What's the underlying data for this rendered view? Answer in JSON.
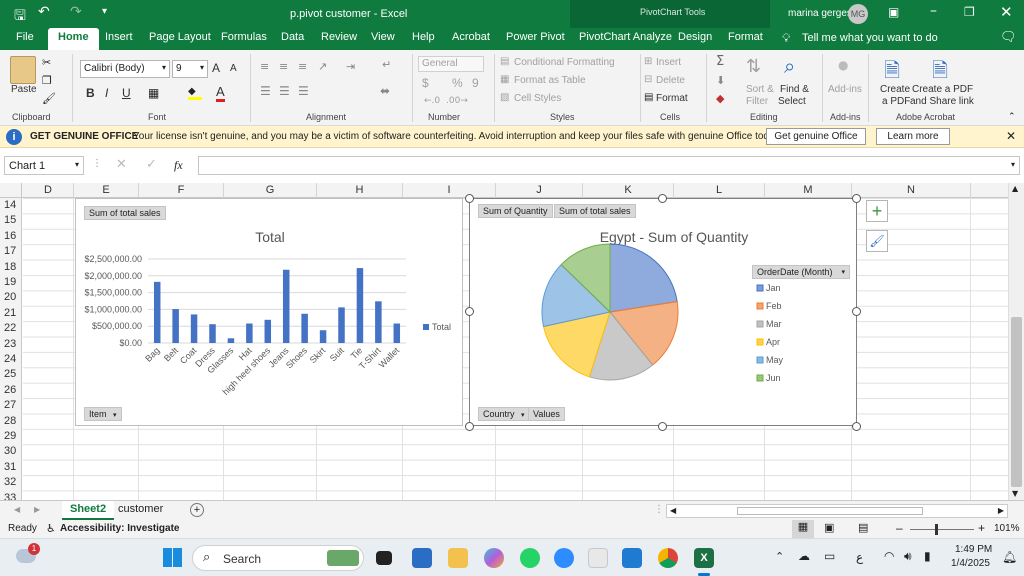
{
  "titlebar": {
    "doc_title": "p.pivot customer  -  Excel",
    "tools_label": "PivotChart Tools",
    "user_name": "marina gerges",
    "user_initials": "MG"
  },
  "tabs": [
    "File",
    "Home",
    "Insert",
    "Page Layout",
    "Formulas",
    "Data",
    "Review",
    "View",
    "Help",
    "Acrobat",
    "Power Pivot",
    "PivotChart Analyze",
    "Design",
    "Format"
  ],
  "active_tab": "Home",
  "tell_me": "Tell me what you want to do",
  "ribbon": {
    "clipboard": {
      "paste": "Paste",
      "label": "Clipboard"
    },
    "font": {
      "name": "Calibri (Body)",
      "size": "9",
      "bold": "B",
      "italic": "I",
      "underline": "U",
      "grow": "A",
      "shrink": "A",
      "label": "Font"
    },
    "alignment": {
      "label": "Alignment"
    },
    "number": {
      "format": "General",
      "currency": "$",
      "percent": "%",
      "comma": "9",
      "label": "Number"
    },
    "styles": {
      "conditional": "Conditional Formatting",
      "table": "Format as Table",
      "cell": "Cell Styles",
      "label": "Styles"
    },
    "cells": {
      "insert": "Insert",
      "delete": "Delete",
      "format": "Format",
      "label": "Cells"
    },
    "editing": {
      "sort": "Sort &",
      "filter": "Filter",
      "find": "Find &",
      "select": "Select",
      "label": "Editing"
    },
    "addins": {
      "name": "Add-ins",
      "label": "Add-ins"
    },
    "acrobat": {
      "create_pdf_1": "Create",
      "create_pdf_2": "a PDF",
      "share_1": "Create a PDF",
      "share_2": "and Share link",
      "label": "Adobe Acrobat"
    }
  },
  "message_bar": {
    "title": "GET GENUINE OFFICE",
    "text": "Your license isn't genuine, and you may be a victim of software counterfeiting. Avoid interruption and keep your files safe with genuine Office today.",
    "get_button": "Get genuine Office",
    "learn_button": "Learn more"
  },
  "formula_bar": {
    "name_box": "Chart 1",
    "fx": "fx",
    "formula": ""
  },
  "columns": [
    "D",
    "E",
    "F",
    "G",
    "H",
    "I",
    "J",
    "K",
    "L",
    "M",
    "N"
  ],
  "rows": [
    "14",
    "15",
    "16",
    "17",
    "18",
    "19",
    "20",
    "21",
    "22",
    "23",
    "24",
    "25",
    "26",
    "27",
    "28",
    "29",
    "30",
    "31",
    "32",
    "33"
  ],
  "chart_data": [
    {
      "type": "bar",
      "title": "Total",
      "field_button_top": "Sum of total sales",
      "field_button_bottom": "Item",
      "categories": [
        "Bag",
        "Belt",
        "Coat",
        "Dress",
        "Glasses",
        "Hat",
        "high heel shoes",
        "Jeans",
        "Shoes",
        "Skirt",
        "Suit",
        "Tie",
        "T-Shirt",
        "Wallet"
      ],
      "series": [
        {
          "name": "Total",
          "values": [
            1820000,
            1010000,
            850000,
            560000,
            140000,
            580000,
            690000,
            2180000,
            870000,
            380000,
            1060000,
            2230000,
            1240000,
            580000
          ]
        }
      ],
      "yticks": [
        "$0.00",
        "$500,000.00",
        "$1,000,000.00",
        "$1,500,000.00",
        "$2,000,000.00",
        "$2,500,000.00"
      ],
      "ylim": [
        0,
        2500000
      ],
      "legend": "right",
      "color": "#4472c4"
    },
    {
      "type": "pie",
      "title": "Egypt - Sum of Quantity",
      "field_buttons_top": [
        "Sum of Quantity",
        "Sum of total sales"
      ],
      "field_buttons_bottom": [
        "Country",
        "Values"
      ],
      "legend_title": "OrderDate (Month)",
      "labels": [
        "Jan",
        "Feb",
        "Mar",
        "Apr",
        "May",
        "Jun"
      ],
      "values": [
        23,
        17,
        16,
        17,
        16,
        13
      ],
      "colors": [
        "#4472c4",
        "#ed7d31",
        "#a5a5a5",
        "#ffc000",
        "#5b9bd5",
        "#70ad47"
      ],
      "legend": "right"
    }
  ],
  "sheets": [
    "Sheet2",
    "customer"
  ],
  "active_sheet": "Sheet2",
  "status": {
    "ready": "Ready",
    "accessibility": "Accessibility: Investigate",
    "zoom": "101%"
  },
  "taskbar": {
    "search": "Search",
    "time": "1:49 PM",
    "date": "1/4/2025",
    "lang": "ع",
    "badge": "1"
  }
}
